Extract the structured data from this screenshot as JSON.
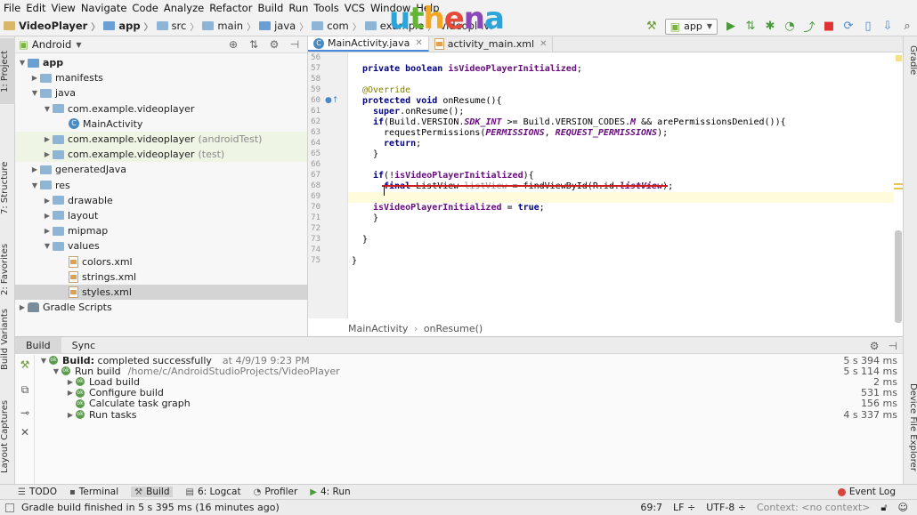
{
  "menu": [
    "File",
    "Edit",
    "View",
    "Navigate",
    "Code",
    "Analyze",
    "Refactor",
    "Build",
    "Run",
    "Tools",
    "VCS",
    "Window",
    "Help"
  ],
  "logo": [
    "u",
    "t",
    "h",
    "e",
    "n",
    "a"
  ],
  "nav": {
    "project": "VideoPlayer",
    "crumbs": [
      "app",
      "src",
      "main",
      "java",
      "com",
      "example",
      "videopl",
      "ivi"
    ]
  },
  "run_config": "app",
  "left_tabs": [
    "1: Project",
    "7: Structure",
    "2: Favorites",
    "Build Variants",
    "Layout Captures"
  ],
  "right_tabs": [
    "Gradle",
    "Device File Explorer"
  ],
  "project_view": "Android",
  "tree": [
    {
      "label": "app",
      "suffix": "",
      "bold": true
    },
    {
      "label": "manifests",
      "suffix": ""
    },
    {
      "label": "java",
      "suffix": ""
    },
    {
      "label": "com.example.videoplayer",
      "suffix": ""
    },
    {
      "label": "MainActivity",
      "suffix": ""
    },
    {
      "label": "com.example.videoplayer",
      "suffix": "(androidTest)"
    },
    {
      "label": "com.example.videoplayer",
      "suffix": "(test)"
    },
    {
      "label": "generatedJava",
      "suffix": ""
    },
    {
      "label": "res",
      "suffix": ""
    },
    {
      "label": "drawable",
      "suffix": ""
    },
    {
      "label": "layout",
      "suffix": ""
    },
    {
      "label": "mipmap",
      "suffix": ""
    },
    {
      "label": "values",
      "suffix": ""
    },
    {
      "label": "colors.xml",
      "suffix": ""
    },
    {
      "label": "strings.xml",
      "suffix": ""
    },
    {
      "label": "styles.xml",
      "suffix": ""
    },
    {
      "label": "Gradle Scripts",
      "suffix": ""
    }
  ],
  "editor_tabs": [
    "MainActivity.java",
    "activity_main.xml"
  ],
  "line_numbers": [
    "56",
    "57",
    "58",
    "59",
    "60",
    "61",
    "62",
    "63",
    "64",
    "65",
    "66",
    "67",
    "68",
    "69",
    "70",
    "71",
    "72",
    "73",
    "74",
    "75"
  ],
  "code": {
    "l57_kw": "private boolean",
    "l57_field": "isVideoPlayerInitialized",
    "l57_end": ";",
    "l59": "@Override",
    "l60_kw": "protected void",
    "l60_rest": " onResume(){",
    "l61_kw": "super",
    "l61_rest": ".onResume();",
    "l62_kw": "if",
    "l62_a": "(Build.VERSION.",
    "l62_f": "SDK_INT",
    "l62_b": " >= Build.VERSION_CODES.",
    "l62_f2": "M",
    "l62_c": " && arePermissionsDenied()){",
    "l63_a": "requestPermissions(",
    "l63_f": "PERMISSIONS",
    "l63_b": ", ",
    "l63_f2": "REQUEST_PERMISSIONS",
    "l63_c": ");",
    "l64_kw": "return",
    "l64_rest": ";",
    "l65": "}",
    "l67_kw": "if",
    "l67_a": "(!",
    "l67_f": "isVideoPlayerInitialized",
    "l67_b": "){",
    "l68_kw": "final",
    "l68_a": " ListView ",
    "l68_u": "listView",
    "l68_b": " = findViewById(R.id.",
    "l68_f": "listView",
    "l68_c": ");",
    "l70_f": "isVideoPlayerInitialized",
    "l70_a": " = ",
    "l70_kw": "true",
    "l70_b": ";",
    "l71": "}",
    "l73": "}",
    "l75": "}"
  },
  "editor_breadcrumb": [
    "MainActivity",
    "onResume()"
  ],
  "build": {
    "tabs": [
      "Build",
      "Sync"
    ],
    "rows": [
      {
        "label": "Build:",
        "text": "completed successfully",
        "extra": "at 4/9/19 9:23 PM",
        "time": "5 s 394 ms"
      },
      {
        "label": "Run build",
        "text": "",
        "extra": "/home/c/AndroidStudioProjects/VideoPlayer",
        "time": "5 s 114 ms"
      },
      {
        "label": "Load build",
        "text": "",
        "extra": "",
        "time": "2 ms"
      },
      {
        "label": "Configure build",
        "text": "",
        "extra": "",
        "time": "531 ms"
      },
      {
        "label": "Calculate task graph",
        "text": "",
        "extra": "",
        "time": "156 ms"
      },
      {
        "label": "Run tasks",
        "text": "",
        "extra": "",
        "time": "4 s 337 ms"
      }
    ]
  },
  "bottom_tabs": [
    "TODO",
    "Terminal",
    "Build",
    "6: Logcat",
    "Profiler",
    "4: Run"
  ],
  "event_log": "Event Log",
  "status": {
    "message": "Gradle build finished in 5 s 395 ms (16 minutes ago)",
    "position": "69:7",
    "line_sep": "LF ÷",
    "encoding": "UTF-8 ÷",
    "context": "Context: <no context>"
  }
}
